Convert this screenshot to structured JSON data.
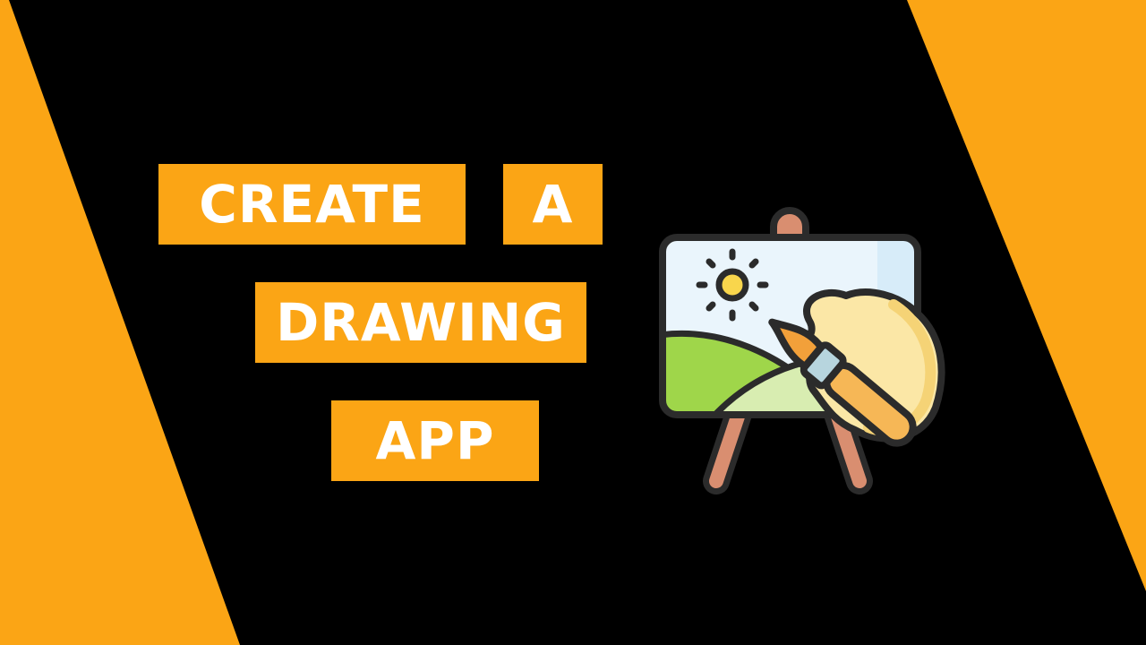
{
  "title_words": [
    "CREATE",
    "A",
    "DRAWING",
    "APP"
  ],
  "colors": {
    "background": "#000000",
    "accent": "#FBA515",
    "text": "#FFFFFF",
    "outline": "#2B2B2B",
    "canvas": "#EAF5FC",
    "sun": "#F9D64C",
    "hill_dark": "#9FD64A",
    "hill_light": "#D8EDB1",
    "easel_wood": "#D98E70",
    "paint_blob": "#FBE7A6",
    "brush_handle": "#F6B756",
    "brush_ferrule": "#B7D5DE",
    "brush_tip": "#F2A03A"
  },
  "icons": [
    "easel-painting-icon",
    "sun-icon",
    "paintbrush-icon"
  ]
}
